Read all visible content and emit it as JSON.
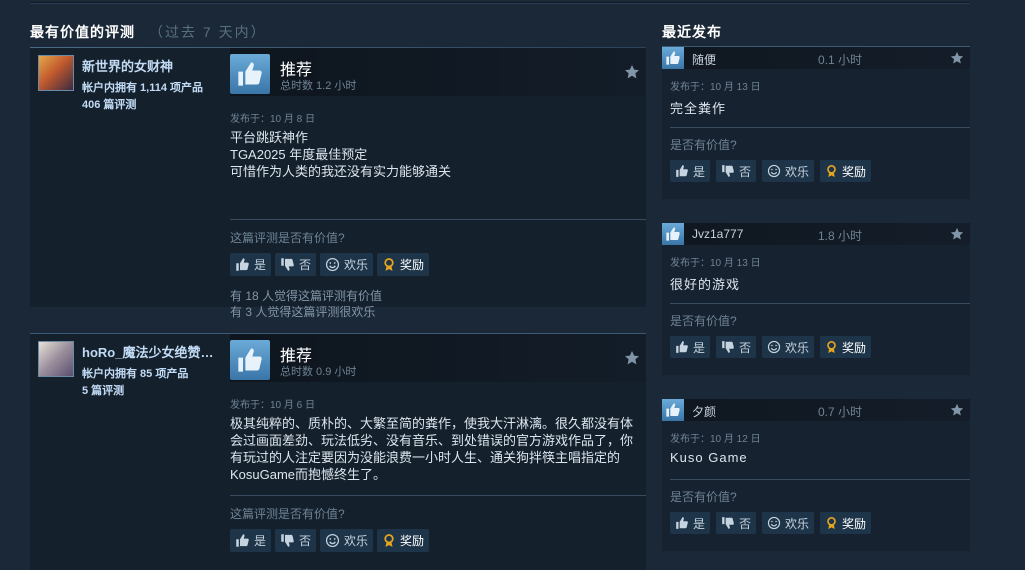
{
  "most_helpful": {
    "title": "最有价值的评测",
    "subtitle": "（过去 7 天内）",
    "reviews": [
      {
        "author": "新世界的女财神",
        "products": "帐户内拥有 1,114 项产品",
        "review_count": "406 篇评测",
        "verdict": "推荐",
        "hours": "总时数 1.2 小时",
        "posted": "发布于：10 月 8 日",
        "lines": [
          "平台跳跃神作",
          "TGA2025 年度最佳预定",
          "可惜作为人类的我还没有实力能够通关"
        ],
        "helpful_prompt": "这篇评测是否有价值?",
        "stat_helpful": "有 18 人觉得这篇评测有价值",
        "stat_funny": "有 3 人觉得这篇评测很欢乐"
      },
      {
        "author": "hoRo_魔法少女绝赞…",
        "products": "帐户内拥有 85 项产品",
        "review_count": "5 篇评测",
        "verdict": "推荐",
        "hours": "总时数 0.9 小时",
        "posted": "发布于：10 月 6 日",
        "lines": [
          "极其纯粹的、质朴的、大繁至简的粪作，使我大汗淋漓。很久都没有体",
          "会过画面差劲、玩法低劣、没有音乐、到处错误的官方游戏作品了，你",
          "有玩过的人注定要因为没能浪费一小时人生、通关狗拌筷主唱指定的",
          "KosuGame而抱憾终生了。"
        ],
        "helpful_prompt": "这篇评测是否有价值?"
      }
    ]
  },
  "buttons": {
    "yes": "是",
    "no": "否",
    "funny": "欢乐",
    "award": "奖励"
  },
  "recent": {
    "title": "最近发布",
    "reviews": [
      {
        "author": "随便",
        "hours": "0.1 小时",
        "posted": "发布于：10 月 13 日",
        "text": "完全粪作",
        "helpful_prompt": "是否有价值?"
      },
      {
        "author": "Jvz1a777",
        "hours": "1.8 小时",
        "posted": "发布于：10 月 13 日",
        "text": "很好的游戏",
        "helpful_prompt": "是否有价值?"
      },
      {
        "author": "夕颜",
        "hours": "0.7 小时",
        "posted": "发布于：10 月 12 日",
        "text": "Kuso Game",
        "helpful_prompt": "是否有价值?"
      }
    ]
  },
  "icons": {
    "thumb": "thumbs-up-icon",
    "star": "star-icon",
    "award": "award-ribbon-icon",
    "funny": "smiley-icon"
  },
  "colors": {
    "background": "#1b2838",
    "thumb_blue": "#4f94c9",
    "link": "#c1dbf4",
    "award": "#e5a51e"
  }
}
